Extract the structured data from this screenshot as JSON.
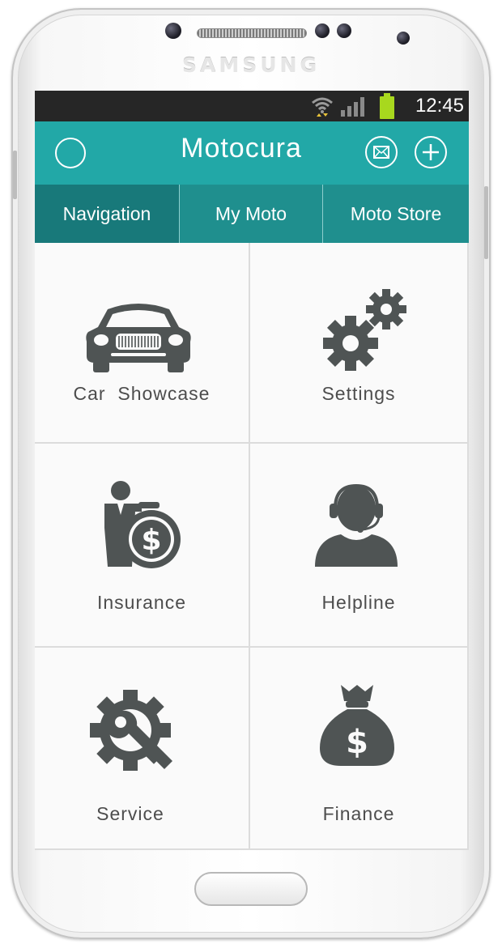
{
  "device": {
    "brand": "SAMSUNG"
  },
  "status_bar": {
    "time": "12:45"
  },
  "app_bar": {
    "title": "Motocura",
    "accent_color": "#22a8a7"
  },
  "tabs": [
    {
      "label": "Navigation",
      "active": true
    },
    {
      "label": "My Moto",
      "active": false
    },
    {
      "label": "Moto Store",
      "active": false
    }
  ],
  "tiles": [
    {
      "label": "Car  Showcase",
      "icon": "car-icon"
    },
    {
      "label": "Settings",
      "icon": "gears-icon"
    },
    {
      "label": "Insurance",
      "icon": "insurance-icon"
    },
    {
      "label": "Helpline",
      "icon": "headset-agent-icon"
    },
    {
      "label": "Service",
      "icon": "wrench-gear-icon"
    },
    {
      "label": "Finance",
      "icon": "money-bag-icon"
    }
  ]
}
